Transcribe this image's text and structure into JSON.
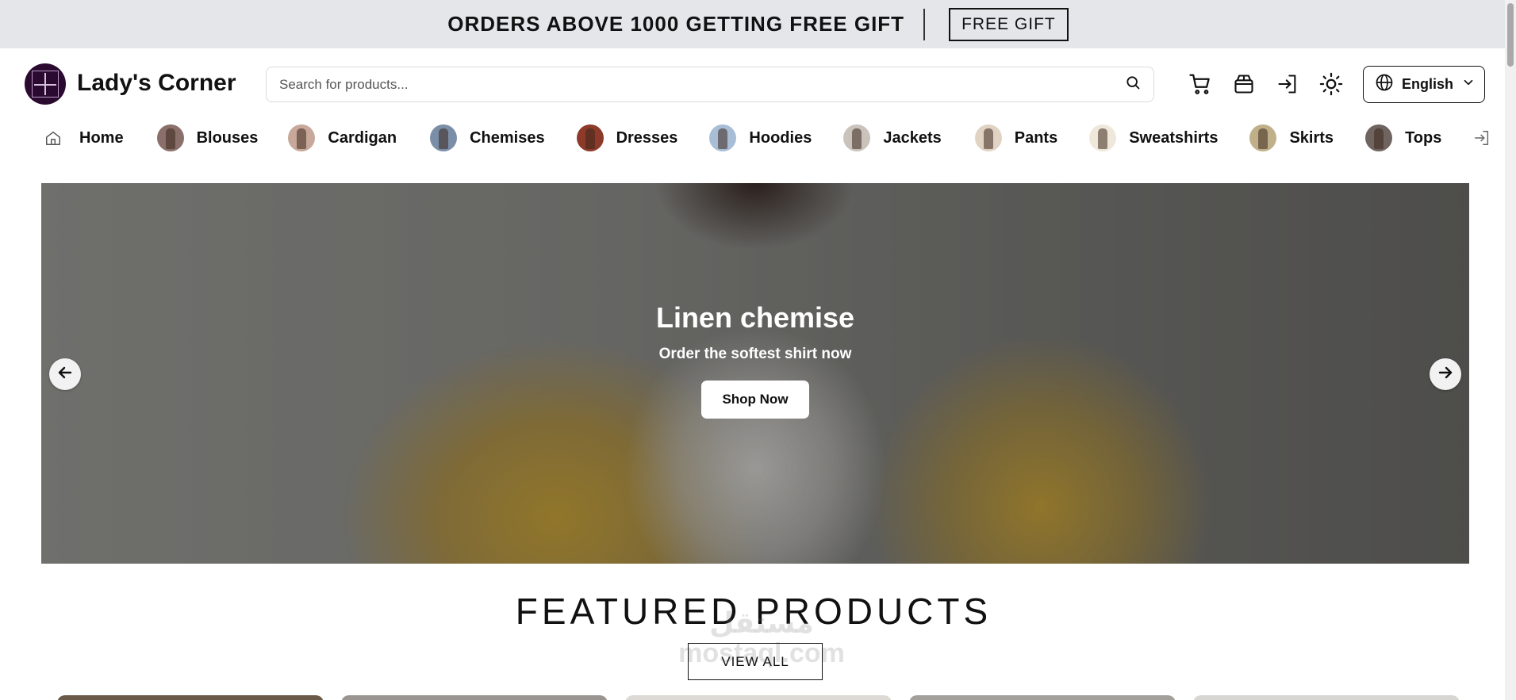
{
  "promo": {
    "text": "ORDERS ABOVE 1000 GETTING FREE GIFT",
    "button_label": "FREE GIFT"
  },
  "header": {
    "brand": "Lady's Corner",
    "search_placeholder": "Search for products...",
    "language": "English",
    "icons": [
      "search-icon",
      "cart-icon",
      "orders-box-icon",
      "login-icon",
      "theme-sun-icon",
      "globe-icon",
      "chevron-down-icon"
    ]
  },
  "categories": {
    "home": "Home",
    "items": [
      "Blouses",
      "Cardigan",
      "Chemises",
      "Dresses",
      "Hoodies",
      "Jackets",
      "Pants",
      "Sweatshirts",
      "Skirts",
      "Tops"
    ],
    "thumb_colors": [
      "#8a6f6a",
      "#c7a89a",
      "#7b8ea8",
      "#8e3a2a",
      "#a8bdd6",
      "#c9c3bc",
      "#e0d3c3",
      "#efe7da",
      "#c0b08a",
      "#6f6460"
    ]
  },
  "hero": {
    "title": "Linen chemise",
    "subtitle": "Order the softest shirt now",
    "button_label": "Shop Now"
  },
  "featured": {
    "title": "FEATURED PRODUCTS",
    "view_all": "VIEW ALL",
    "card_colors": [
      "#6b5a47",
      "#9a9590",
      "#ddd9d4",
      "#a3a09c",
      "#d8d6d3"
    ]
  },
  "watermark": {
    "line1": "مستقل",
    "line2": "mostaql.com"
  },
  "colors": {
    "promo_bg": "#e4e6ea",
    "accent": "#111111",
    "logo_bg": "#2b0a2f"
  }
}
